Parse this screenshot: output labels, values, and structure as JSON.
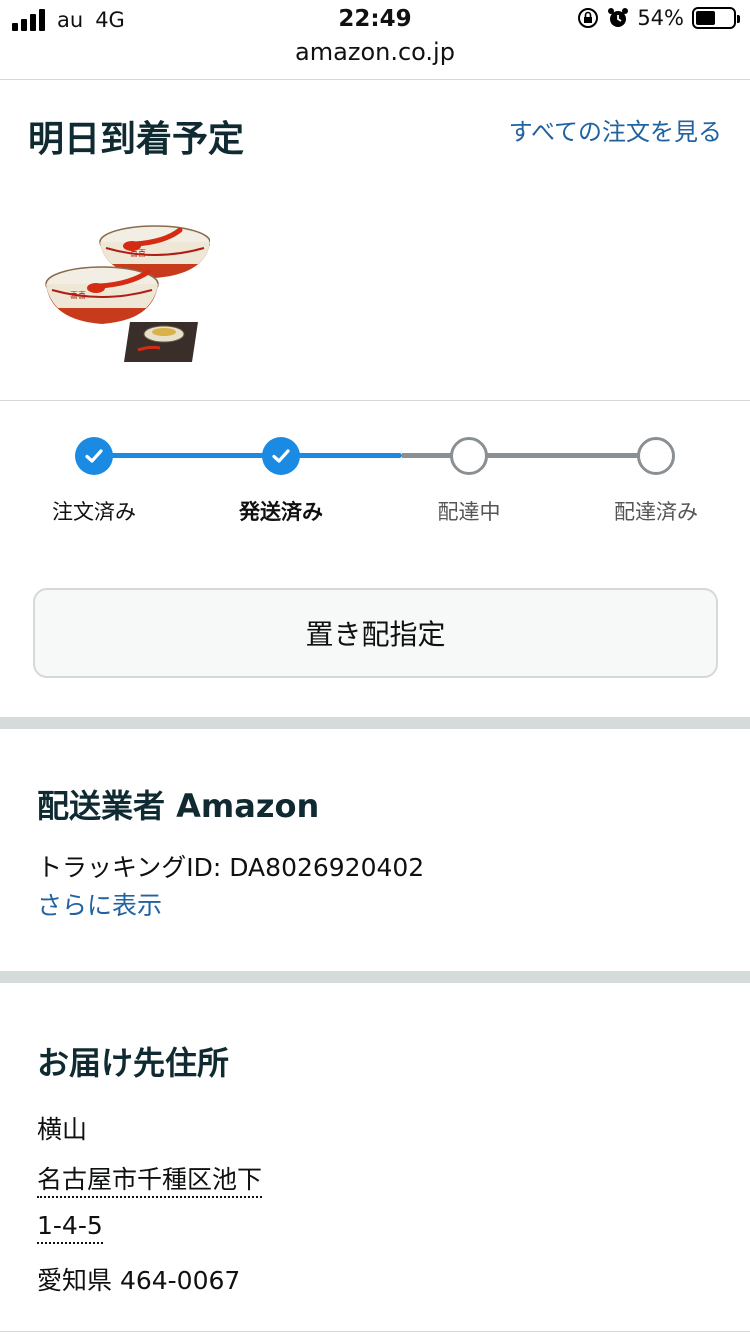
{
  "status_bar": {
    "carrier": "au",
    "network": "4G",
    "time": "22:49",
    "battery_percent": "54%",
    "battery_level": 0.54
  },
  "browser": {
    "url": "amazon.co.jp"
  },
  "header": {
    "title": "明日到着予定",
    "all_orders_link": "すべての注文を見る"
  },
  "product": {
    "icon": "ramen-bowl-set-image"
  },
  "progress": {
    "accent_color": "#1a8ae3",
    "steps": [
      {
        "label": "注文済み",
        "state": "done"
      },
      {
        "label": "発送済み",
        "state": "current"
      },
      {
        "label": "配達中",
        "state": "pending"
      },
      {
        "label": "配達済み",
        "state": "pending"
      }
    ]
  },
  "leave_at_door_button": "置き配指定",
  "carrier": {
    "title": "配送業者 Amazon",
    "tracking": "トラッキングID: DA8026920402",
    "more_link": "さらに表示"
  },
  "address": {
    "title": "お届け先住所",
    "name": "横山",
    "line1": "名古屋市千種区池下",
    "line2": "1-4-5",
    "line3": "愛知県 464-0067"
  }
}
